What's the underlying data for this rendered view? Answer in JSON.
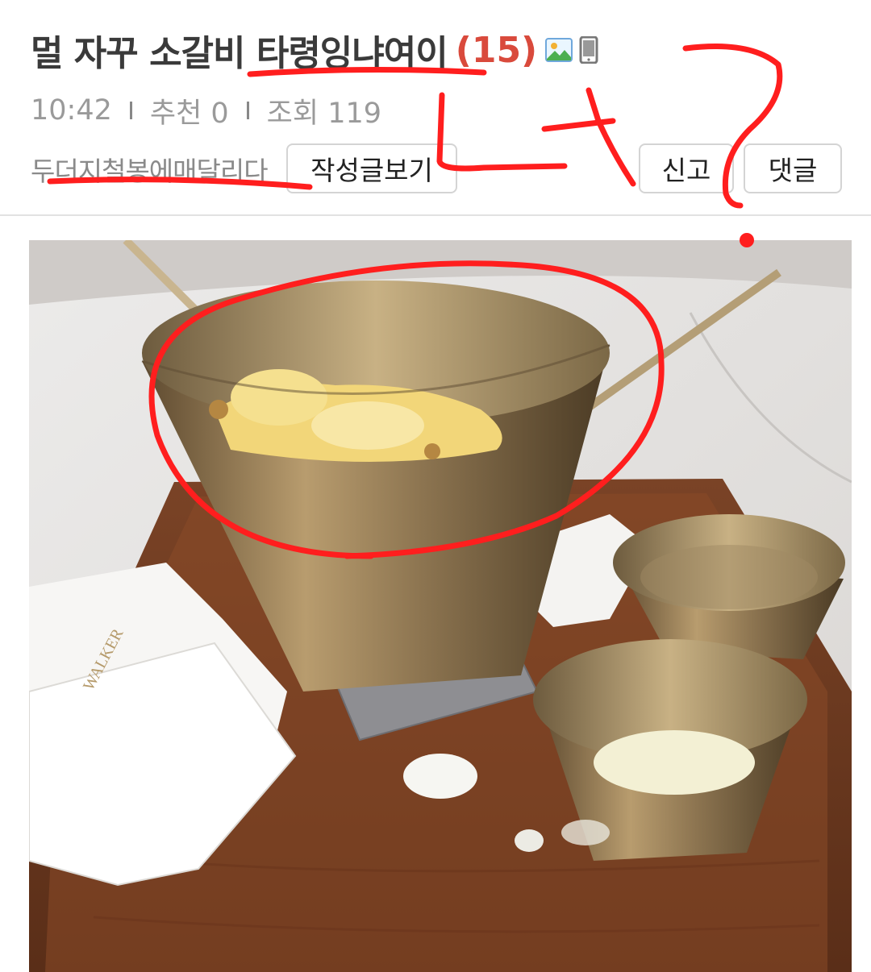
{
  "post": {
    "title": "멀 자꾸 소갈비 타령잉냐여이",
    "comment_count": "(15)",
    "time": "10:42",
    "recommend": "추천 0",
    "views": "조회 119",
    "author": "두더지철봉에매달리다"
  },
  "buttons": {
    "view_posts": "작성글보기",
    "report": "신고",
    "comments": "댓글"
  },
  "photo": {
    "napkin_brand": "WALKER"
  },
  "annotation": {
    "handwriting": "너?",
    "color": "#ff1e1e"
  },
  "icons": [
    "image-icon",
    "mobile-icon"
  ]
}
